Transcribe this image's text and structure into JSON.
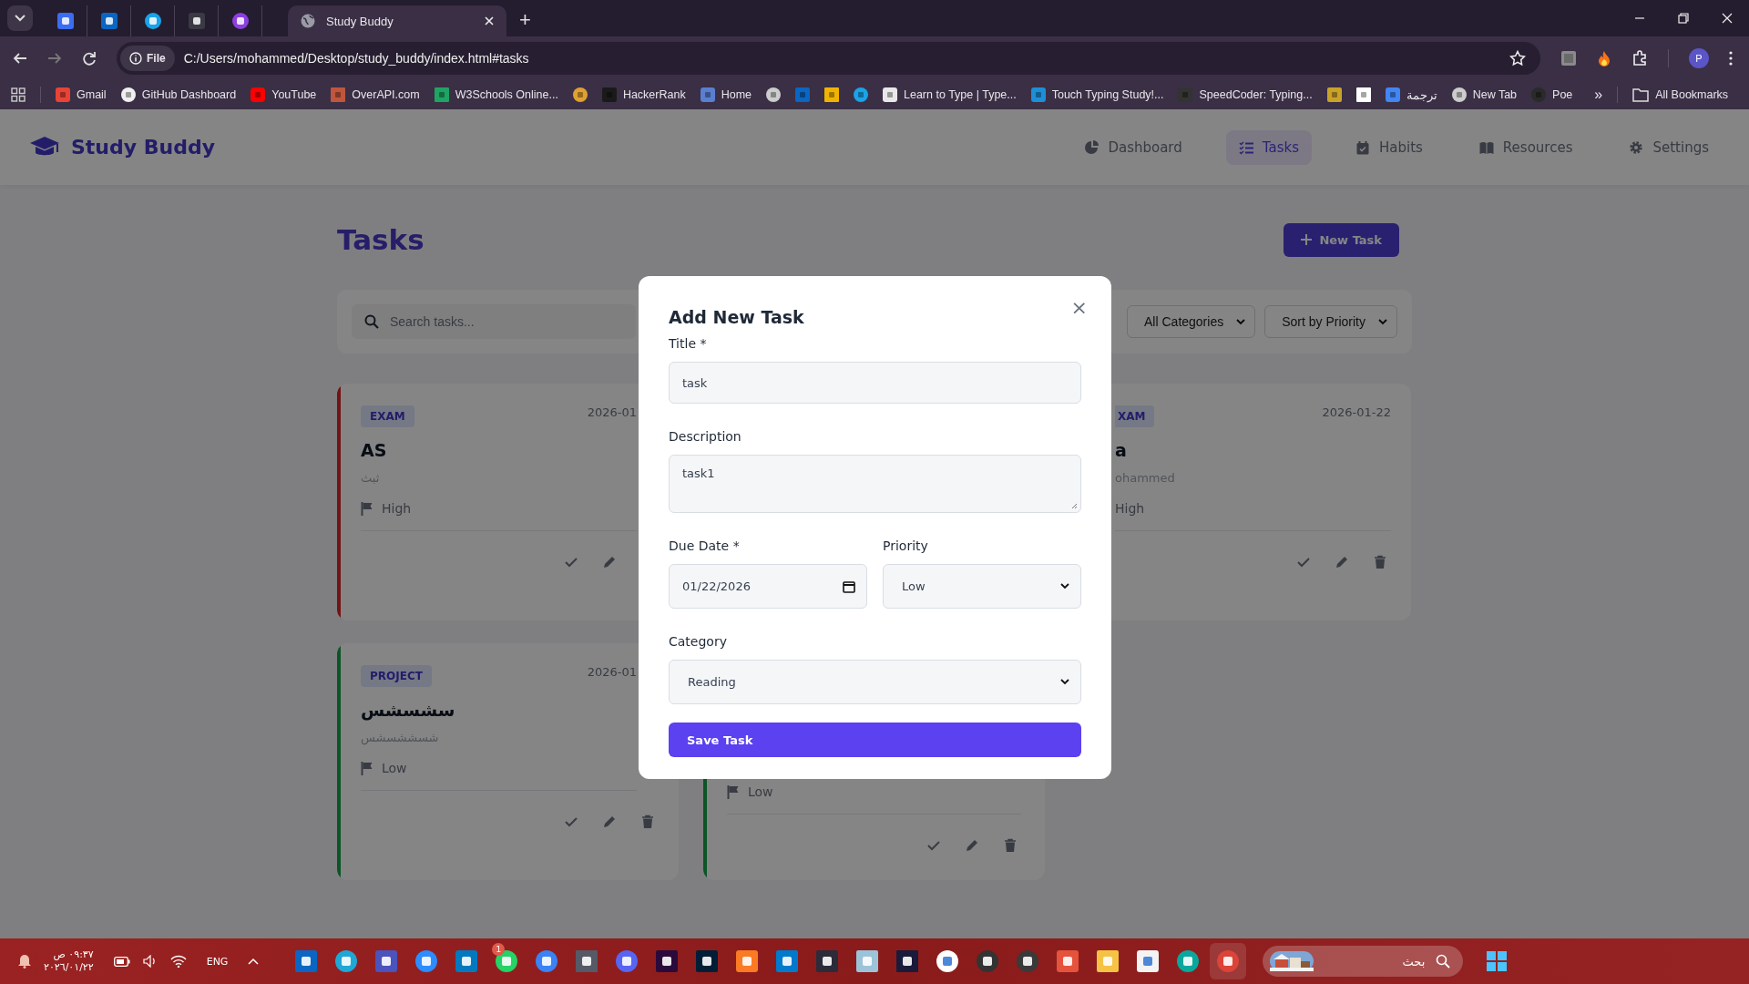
{
  "browser": {
    "tabs": [
      {
        "kind": "pinned",
        "selected": false
      },
      {
        "kind": "pinned",
        "selected": false
      },
      {
        "kind": "pinned",
        "selected": false
      },
      {
        "kind": "pinned",
        "selected": false
      },
      {
        "kind": "pinned",
        "selected": false
      },
      {
        "kind": "page",
        "title": "Study Buddy",
        "selected": true
      }
    ],
    "new_tab": "+",
    "address": {
      "scheme": "File",
      "url": "C:/Users/mohammed/Desktop/study_buddy/index.html#tasks"
    },
    "bookmarks": [
      {
        "kind": "link",
        "label": "Gmail"
      },
      {
        "kind": "link",
        "label": "GitHub Dashboard"
      },
      {
        "kind": "link",
        "label": "YouTube"
      },
      {
        "kind": "link",
        "label": "OverAPI.com"
      },
      {
        "kind": "link",
        "label": "W3Schools Online..."
      },
      {
        "kind": "icon"
      },
      {
        "kind": "link",
        "label": "HackerRank"
      },
      {
        "kind": "link",
        "label": "Home"
      },
      {
        "kind": "icon"
      },
      {
        "kind": "icon"
      },
      {
        "kind": "icon"
      },
      {
        "kind": "icon"
      },
      {
        "kind": "link",
        "label": "Learn to Type | Type..."
      },
      {
        "kind": "link",
        "label": "Touch Typing Study!..."
      },
      {
        "kind": "link",
        "label": "SpeedCoder: Typing..."
      },
      {
        "kind": "icon"
      },
      {
        "kind": "icon"
      },
      {
        "kind": "link",
        "label": "ترجمة"
      },
      {
        "kind": "link",
        "label": "New Tab"
      },
      {
        "kind": "link",
        "label": "Poe"
      }
    ],
    "overflow": "»",
    "all_bookmarks": "All Bookmarks",
    "profile": "P"
  },
  "app": {
    "brand": "Study Buddy",
    "nav": [
      {
        "label": "Dashboard",
        "selected": false
      },
      {
        "label": "Tasks",
        "selected": true
      },
      {
        "label": "Habits",
        "selected": false
      },
      {
        "label": "Resources",
        "selected": false
      },
      {
        "label": "Settings",
        "selected": false
      }
    ],
    "page_title": "Tasks",
    "new_button": "New Task",
    "search": {
      "placeholder": "Search tasks..."
    },
    "filters": [
      "All Categories",
      "Sort by Priority"
    ],
    "cards": [
      {
        "category": "EXAM",
        "date": "2026-01",
        "title": "AS",
        "description": "ثبث",
        "priority": "High",
        "color": "#721414"
      },
      {
        "category": "XAM",
        "date": "2026-01-22",
        "title": "a",
        "description": "ohammed",
        "priority": "High"
      },
      {
        "category": "PROJECT",
        "date": "2026-01",
        "title": "سشسشس",
        "description": "شسششسشس",
        "priority": "Low",
        "color": "#0b5527"
      },
      {
        "priority": "Low",
        "color": "#0b5527"
      }
    ]
  },
  "modal": {
    "title": "Add New Task",
    "close": "×",
    "fields": [
      {
        "kind": "text",
        "label": "Title *",
        "value": "task"
      },
      {
        "kind": "textarea",
        "label": "Description",
        "value": "task1"
      },
      {
        "kind": "date",
        "label": "Due Date *",
        "value": "01/22/2026"
      },
      {
        "kind": "select",
        "label": "Priority",
        "value": "Low"
      },
      {
        "kind": "select",
        "label": "Category",
        "value": "Reading"
      }
    ],
    "save": "Save Task"
  },
  "taskbar": {
    "time": "٠٩:٣٧ ص",
    "date": "٢٠٢٦/٠١/٢٢",
    "language": "ENG",
    "badge": "1",
    "search": {
      "placeholder": "بحث"
    }
  }
}
